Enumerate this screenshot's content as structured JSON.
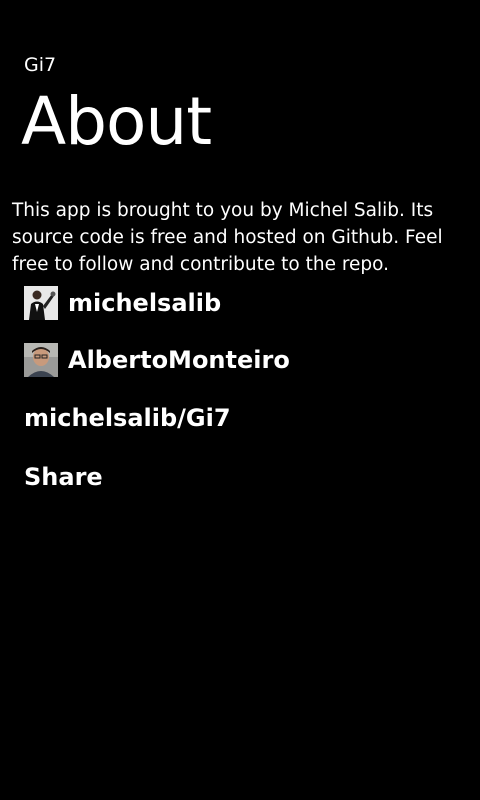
{
  "header": {
    "app_title": "Gi7",
    "page_title": "About"
  },
  "main": {
    "description": "This app is brought to you by Michel Salib. Its source code is free and hosted on Github. Feel free to follow and contribute to the repo.",
    "links": [
      {
        "label": "michelsalib",
        "avatar": "user-photo-michelsalib"
      },
      {
        "label": "AlbertoMonteiro",
        "avatar": "user-photo-albertomonteiro"
      },
      {
        "label": "michelsalib/Gi7"
      },
      {
        "label": "Share"
      }
    ]
  },
  "colors": {
    "background": "#000000",
    "text": "#FFFFFF"
  }
}
